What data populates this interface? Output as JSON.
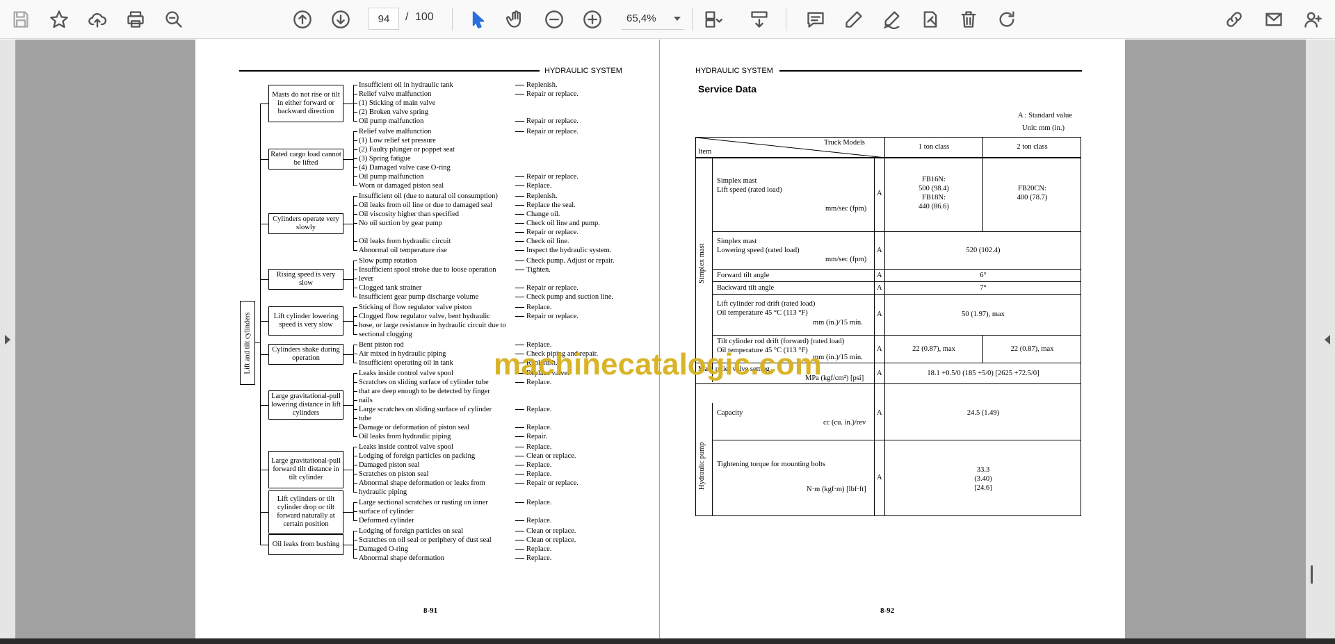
{
  "toolbar": {
    "icons": [
      "save-icon",
      "bookmark-star-icon",
      "upload-cloud-icon",
      "print-icon",
      "zoom-search-icon",
      "prev-page-icon",
      "next-page-icon",
      "select-pointer-icon",
      "hand-pan-icon",
      "zoom-out-icon",
      "zoom-in-icon",
      "page-layout-icon",
      "scroll-mode-icon",
      "comment-icon",
      "pen-icon",
      "sign-icon",
      "redact-icon",
      "delete-icon",
      "rotate-icon",
      "share-link-icon",
      "email-icon",
      "add-user-icon"
    ],
    "current_page": "94",
    "page_separator": "/",
    "total_pages": "100",
    "zoom": "65,4%"
  },
  "left_page": {
    "header": "HYDRAULIC SYSTEM",
    "vertical_label": "Lift and tilt cylinders",
    "page_number": "8-91",
    "groups": [
      {
        "symptom": "Masts do not rise or tilt in either forward or backward direction",
        "causes": [
          [
            "Insufficient oil in hydraulic tank",
            "Replenish."
          ],
          [
            "Relief valve malfunction",
            "Repair or replace."
          ],
          [
            "(1) Sticking of main valve",
            ""
          ],
          [
            "(2) Broken valve spring",
            ""
          ],
          [
            "Oil pump malfunction",
            "Repair or replace."
          ]
        ]
      },
      {
        "symptom": "Rated cargo load cannot be lifted",
        "causes": [
          [
            "Relief valve malfunction",
            "Repair or replace."
          ],
          [
            "(1) Low relief set pressure",
            ""
          ],
          [
            "(2) Faulty plunger or poppet seat",
            ""
          ],
          [
            "(3) Spring fatigue",
            ""
          ],
          [
            "(4) Damaged valve case O-ring",
            ""
          ],
          [
            "Oil pump malfunction",
            "Repair or replace."
          ],
          [
            "Worn or damaged piston seal",
            "Replace."
          ]
        ]
      },
      {
        "symptom": "Cylinders operate very slowly",
        "causes": [
          [
            "Insufficient oil (due to natural oil consumption)",
            "Replenish."
          ],
          [
            "Oil leaks from oil line or due to damaged seal",
            "Replace the seal."
          ],
          [
            "Oil viscosity higher than specified",
            "Change oil."
          ],
          [
            "No oil suction by gear pump",
            "Check oil line and pump."
          ],
          [
            "",
            "Repair or replace."
          ],
          [
            "Oil leaks from hydraulic circuit",
            "Check oil line."
          ],
          [
            "Abnormal oil temperature rise",
            "Inspect the hydraulic system."
          ]
        ]
      },
      {
        "symptom": "Rising speed is very slow",
        "causes": [
          [
            "Slow pump rotation",
            "Check pump.  Adjust or repair."
          ],
          [
            "Insufficient spool stroke due to loose operation",
            "Tighten."
          ],
          [
            "lever",
            ""
          ],
          [
            "Clogged tank strainer",
            "Repair or replace."
          ],
          [
            "Insufficient gear pump discharge volume",
            "Check pump and suction line."
          ]
        ]
      },
      {
        "symptom": "Lift cylinder lowering speed is very slow",
        "causes": [
          [
            "Sticking of flow regulator valve piston",
            "Replace."
          ],
          [
            "Clogged flow regulator valve, bent hydraulic",
            "Repair or replace."
          ],
          [
            "hose, or large resistance in hydraulic circuit due to",
            ""
          ],
          [
            "sectional clogging",
            ""
          ]
        ]
      },
      {
        "symptom": "Cylinders shake during operation",
        "causes": [
          [
            "Bent piston rod",
            "Replace."
          ],
          [
            "Air mixed in hydraulic piping",
            "Check piping and repair."
          ],
          [
            "Insufficient operating oil in tank",
            "Replenish."
          ]
        ]
      },
      {
        "symptom": "Large gravitational-pull lowering distance in lift cylinders",
        "causes": [
          [
            "Leaks inside control valve spool",
            "Replace valve."
          ],
          [
            "Scratches on sliding surface of cylinder tube",
            "Replace."
          ],
          [
            "that are deep enough to be detected by finger",
            ""
          ],
          [
            "nails",
            ""
          ],
          [
            "Large scratches on sliding surface of cylinder",
            "Replace."
          ],
          [
            "tube",
            ""
          ],
          [
            "Damage or deformation of piston seal",
            "Replace."
          ],
          [
            "Oil leaks from hydraulic piping",
            "Repair."
          ]
        ]
      },
      {
        "symptom": "Large gravitational-pull forward tilt distance in tilt cylinder",
        "causes": [
          [
            "Leaks inside control valve spool",
            "Replace."
          ],
          [
            "Lodging of foreign particles on packing",
            "Clean or replace."
          ],
          [
            "Damaged piston seal",
            "Replace."
          ],
          [
            "Scratches on piston seal",
            "Replace."
          ],
          [
            "Abnormal shape deformation or leaks from",
            "Repair or replace."
          ],
          [
            "hydraulic piping",
            ""
          ]
        ]
      },
      {
        "symptom": "Lift cylinders or tilt cylinder drop or tilt forward naturally at certain position",
        "causes": [
          [
            "Large sectional scratches or rusting on inner",
            "Replace."
          ],
          [
            "surface of cylinder",
            ""
          ],
          [
            "Deformed cylinder",
            "Replace."
          ]
        ]
      },
      {
        "symptom": "Oil leaks from bushing",
        "causes": [
          [
            "Lodging of foreign particles on seal",
            "Clean or replace."
          ],
          [
            "Scratches on oil seal or periphery of dust seal",
            "Clean or replace."
          ],
          [
            "Damaged O-ring",
            "Replace."
          ],
          [
            "Abnormal shape deformation",
            "Replace."
          ]
        ]
      }
    ]
  },
  "right_page": {
    "header": "HYDRAULIC SYSTEM",
    "title": "Service Data",
    "note_a": "A :  Standard value",
    "note_unit": "Unit: mm (in.)",
    "page_number": "8-92",
    "table": {
      "head_truck_models": "Truck Models",
      "head_item": "Item",
      "col1": "1 ton class",
      "col2": "2 ton class",
      "group_simplex": "Simplex mast",
      "group_pump": "Hydraulic pump",
      "rows": {
        "lift_speed_l1": "Simplex mast",
        "lift_speed_l2": "Lift speed (rated load)",
        "lift_speed_unit": "mm/sec (fpm)",
        "lift_speed_a": "A",
        "lift_speed_c1": [
          "FB16N:",
          "500 (98.4)",
          "FB18N:",
          "440 (86.6)"
        ],
        "lift_speed_c2": [
          "FB20CN:",
          "400 (78.7)"
        ],
        "lower_l1": "Simplex mast",
        "lower_l2": "Lowering speed (rated load)",
        "lower_unit": "mm/sec (fpm)",
        "lower_a": "A",
        "lower_val": "520 (102.4)",
        "fwd_tilt": "Forward tilt angle",
        "fwd_a": "A",
        "fwd_val": "6°",
        "bwd_tilt": "Backward tilt angle",
        "bwd_a": "A",
        "bwd_val": "7°",
        "lift_drift_l1": "Lift cylinder rod drift (rated load)",
        "lift_drift_l2": "Oil temperature 45 °C (113 °F)",
        "lift_drift_unit": "mm (in.)/15 min.",
        "lift_drift_a": "A",
        "lift_drift_val": "50 (1.97), max",
        "tilt_drift_l1": "Tilt cylinder rod drift (forward) (rated load)",
        "tilt_drift_l2": "Oil temperature 45 °C (113 °F)",
        "tilt_drift_unit": "mm (in.)/15 min.",
        "tilt_drift_a": "A",
        "tilt_drift_c1": "22 (0.87), max",
        "tilt_drift_c2": "22 (0.87), max",
        "relief_l1": "Main relief valve setting",
        "relief_unit": "MPa (kgf/cm²) [psi]",
        "relief_a": "A",
        "relief_val": "18.1 +0.5/0 (185 +5/0) [2625 +72.5/0]",
        "cap_l1": "Capacity",
        "cap_unit": "cc (cu. in.)/rev",
        "cap_a": "A",
        "cap_val": "24.5 (1.49)",
        "torque_l1": "Tightening torque for mounting bolts",
        "torque_unit": "N·m (kgf·m) [lbf·ft]",
        "torque_a": "A",
        "torque_val": [
          "33.3",
          "(3.40)",
          "[24.6]"
        ]
      }
    }
  },
  "watermark": "machinecatalogic.com"
}
